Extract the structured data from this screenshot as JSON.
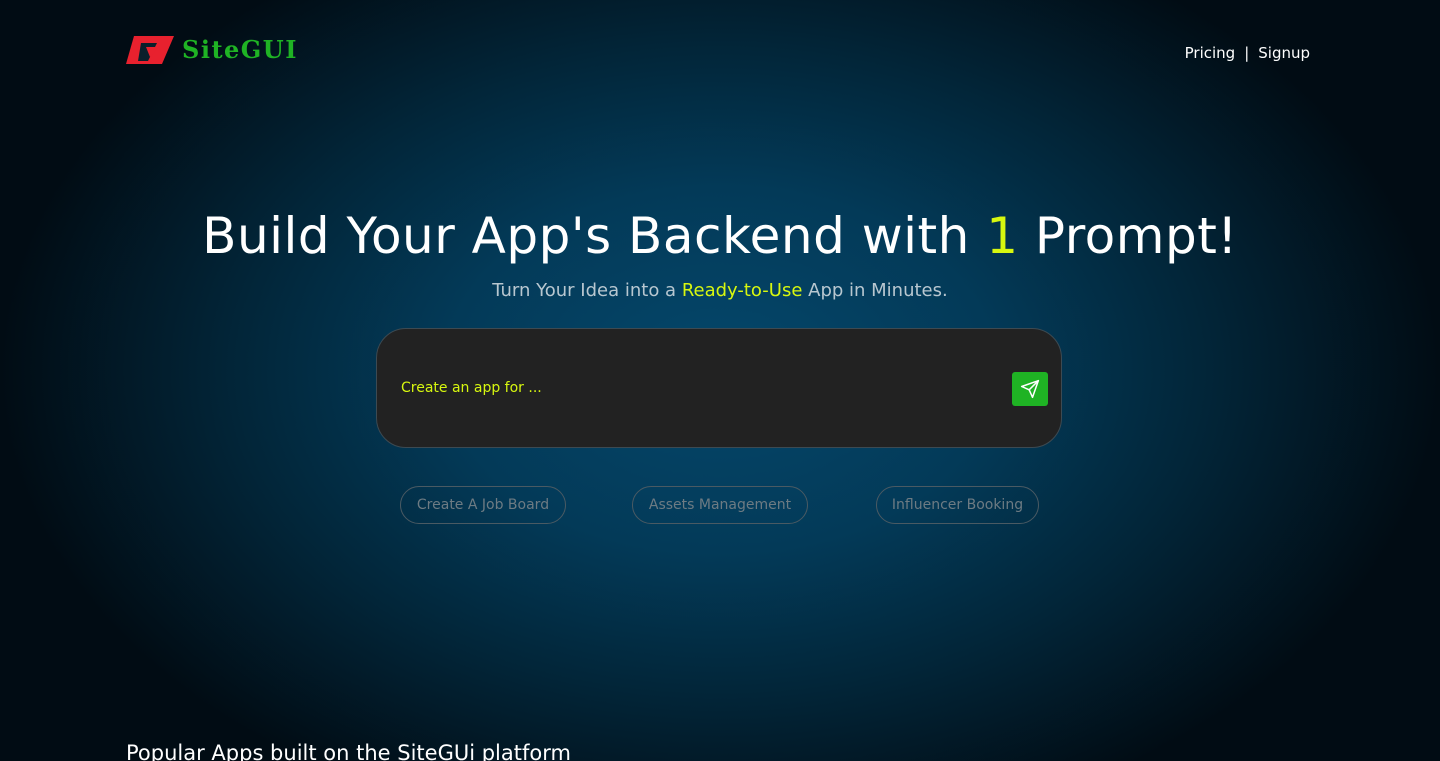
{
  "brand": {
    "name": "SiteGUI",
    "logo_icon": "sitegui-logo-icon",
    "logo_color": "#e8212e",
    "text_color": "#1fb324"
  },
  "nav": {
    "pricing": "Pricing",
    "separator": "|",
    "signup": "Signup"
  },
  "hero": {
    "title_before": "Build Your App's Backend with ",
    "title_highlight": "1",
    "title_after": " Prompt!",
    "subtitle_before": "Turn Your Idea into a ",
    "subtitle_highlight": "Ready-to-Use",
    "subtitle_after": " App in Minutes.",
    "highlight_color": "#d7f70f"
  },
  "prompt": {
    "placeholder": "Create an app for ...",
    "value": "",
    "send_icon": "paper-plane-icon",
    "send_color": "#1fb324"
  },
  "suggestions": [
    {
      "label": "Create A Job Board"
    },
    {
      "label": "Assets Management"
    },
    {
      "label": "Influencer Booking"
    }
  ],
  "popular": {
    "heading": "Popular Apps built on the SiteGUi platform"
  }
}
